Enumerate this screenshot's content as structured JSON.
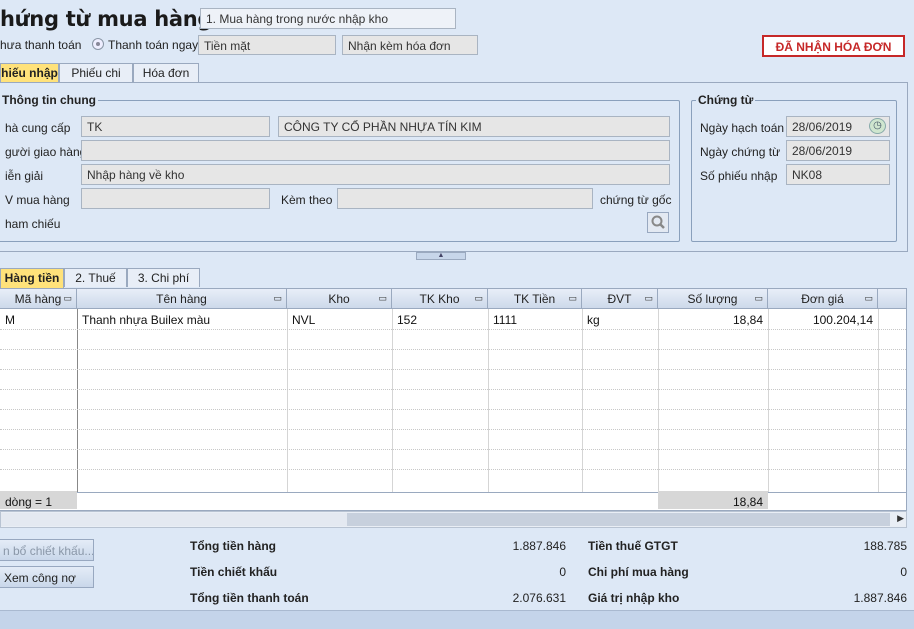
{
  "header": {
    "title": "hứng từ mua hàng",
    "purchase_type": "1. Mua hàng trong nước nhập kho",
    "unpaid_label": "hưa thanh toán",
    "paid_label": "Thanh toán ngay",
    "payment_method": "Tiền mặt",
    "invoice_option": "Nhận kèm hóa đơn",
    "status_badge": "ĐÃ NHẬN HÓA ĐƠN"
  },
  "tabs": [
    {
      "label": "hiếu nhập",
      "active": true
    },
    {
      "label": "Phiếu chi",
      "active": false
    },
    {
      "label": "Hóa đơn",
      "active": false
    }
  ],
  "general": {
    "title": "Thông tin chung",
    "supplier_label": "hà cung cấp",
    "supplier_code": "TK",
    "supplier_name": "CÔNG TY CỔ PHẦN NHỰA TÍN KIM",
    "deliverer_label": "gười giao hàng",
    "deliverer_value": "",
    "desc_label": "iễn giải",
    "desc_value": "Nhập hàng về kho",
    "buyer_label": "V mua hàng",
    "buyer_value": "",
    "attach_label": "Kèm theo",
    "attach_value": "",
    "original_docs_label": "chứng từ gốc",
    "reference_label": "ham chiếu"
  },
  "voucher": {
    "title": "Chứng từ",
    "posting_date_label": "Ngày hạch toán",
    "posting_date": "28/06/2019",
    "voucher_date_label": "Ngày chứng từ",
    "voucher_date": "28/06/2019",
    "number_label": "Số phiếu nhập",
    "number": "NK08"
  },
  "detail_tabs": [
    {
      "label": "Hàng tiền",
      "active": true
    },
    {
      "label": "2. Thuế",
      "active": false
    },
    {
      "label": "3. Chi phí",
      "active": false
    }
  ],
  "grid": {
    "columns": [
      "Mã hàng",
      "Tên hàng",
      "Kho",
      "TK Kho",
      "TK Tiền",
      "ĐVT",
      "Số lượng",
      "Đơn giá"
    ],
    "rows": [
      [
        "M",
        "Thanh nhựa Builex màu",
        "NVL",
        "152",
        "1111",
        "kg",
        "18,84",
        "100.204,14"
      ]
    ],
    "footer_count": "dòng = 1",
    "footer_qty": "18,84"
  },
  "buttons": {
    "allocate_discount": "n bổ chiết khấu...",
    "view_debt": "Xem công nợ"
  },
  "totals": {
    "goods_label": "Tổng tiền hàng",
    "goods_value": "1.887.846",
    "discount_label": "Tiền chiết khấu",
    "discount_value": "0",
    "payment_label": "Tổng tiền thanh toán",
    "payment_value": "2.076.631",
    "vat_label": "Tiền thuế GTGT",
    "vat_value": "188.785",
    "cost_label": "Chi phí mua hàng",
    "cost_value": "0",
    "import_label": "Giá trị nhập kho",
    "import_value": "1.887.846"
  },
  "colors": {
    "status": "#c62828",
    "active_tab": "#ffe27a",
    "background": "#dde8f6"
  }
}
